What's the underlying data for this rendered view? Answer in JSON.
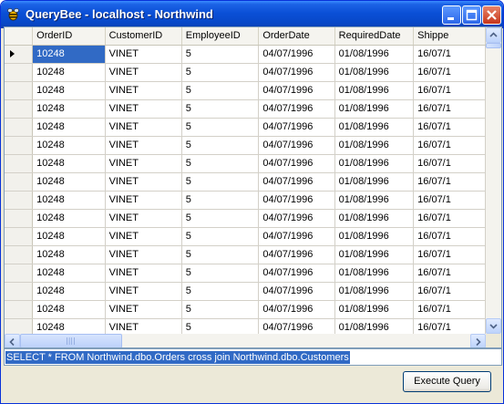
{
  "window": {
    "title": "QueryBee - localhost - Northwind"
  },
  "grid": {
    "columns": [
      "OrderID",
      "CustomerID",
      "EmployeeID",
      "OrderDate",
      "RequiredDate",
      "Shippe"
    ],
    "rows": [
      [
        "10248",
        "VINET",
        "5",
        "04/07/1996",
        "01/08/1996",
        "16/07/1"
      ],
      [
        "10248",
        "VINET",
        "5",
        "04/07/1996",
        "01/08/1996",
        "16/07/1"
      ],
      [
        "10248",
        "VINET",
        "5",
        "04/07/1996",
        "01/08/1996",
        "16/07/1"
      ],
      [
        "10248",
        "VINET",
        "5",
        "04/07/1996",
        "01/08/1996",
        "16/07/1"
      ],
      [
        "10248",
        "VINET",
        "5",
        "04/07/1996",
        "01/08/1996",
        "16/07/1"
      ],
      [
        "10248",
        "VINET",
        "5",
        "04/07/1996",
        "01/08/1996",
        "16/07/1"
      ],
      [
        "10248",
        "VINET",
        "5",
        "04/07/1996",
        "01/08/1996",
        "16/07/1"
      ],
      [
        "10248",
        "VINET",
        "5",
        "04/07/1996",
        "01/08/1996",
        "16/07/1"
      ],
      [
        "10248",
        "VINET",
        "5",
        "04/07/1996",
        "01/08/1996",
        "16/07/1"
      ],
      [
        "10248",
        "VINET",
        "5",
        "04/07/1996",
        "01/08/1996",
        "16/07/1"
      ],
      [
        "10248",
        "VINET",
        "5",
        "04/07/1996",
        "01/08/1996",
        "16/07/1"
      ],
      [
        "10248",
        "VINET",
        "5",
        "04/07/1996",
        "01/08/1996",
        "16/07/1"
      ],
      [
        "10248",
        "VINET",
        "5",
        "04/07/1996",
        "01/08/1996",
        "16/07/1"
      ],
      [
        "10248",
        "VINET",
        "5",
        "04/07/1996",
        "01/08/1996",
        "16/07/1"
      ],
      [
        "10248",
        "VINET",
        "5",
        "04/07/1996",
        "01/08/1996",
        "16/07/1"
      ],
      [
        "10248",
        "VINET",
        "5",
        "04/07/1996",
        "01/08/1996",
        "16/07/1"
      ]
    ]
  },
  "query": {
    "text": "SELECT * FROM Northwind.dbo.Orders cross join Northwind.dbo.Customers"
  },
  "buttons": {
    "execute": "Execute Query"
  },
  "colors": {
    "selection": "#316ac5",
    "titlebar": "#0a4fd6"
  }
}
